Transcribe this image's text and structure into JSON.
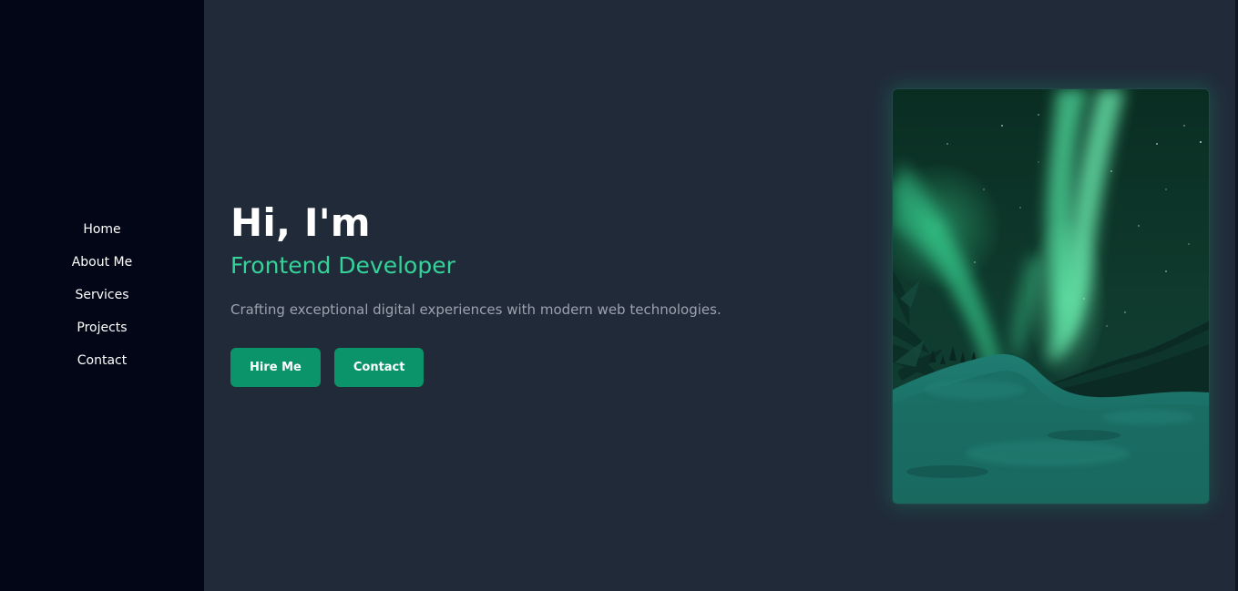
{
  "sidebar": {
    "items": [
      {
        "label": "Home"
      },
      {
        "label": "About Me"
      },
      {
        "label": "Services"
      },
      {
        "label": "Projects"
      },
      {
        "label": "Contact"
      }
    ]
  },
  "hero": {
    "title": "Hi, I'm",
    "role": "Frontend Developer",
    "description": "Crafting exceptional digital experiences with modern web technologies.",
    "hire_label": "Hire Me",
    "contact_label": "Contact"
  },
  "image": {
    "subject": "aurora-borealis-over-snowy-landscape"
  },
  "colors": {
    "sidebar_bg": "#030616",
    "main_bg": "#212a39",
    "accent": "#34d399",
    "button_bg": "#0b936a",
    "text_muted": "#9ca3af"
  }
}
